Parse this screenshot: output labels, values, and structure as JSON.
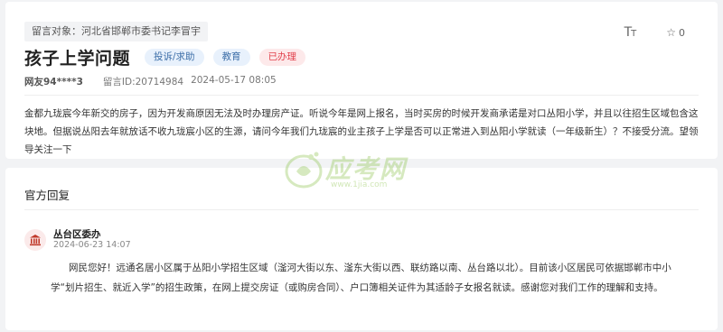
{
  "message": {
    "target": "留言对象：河北省邯郸市委书记李冒宇",
    "title": "孩子上学问题",
    "tags": {
      "type": "投诉/求助",
      "category": "教育",
      "status": "已办理"
    },
    "user": "网友94****3",
    "message_id": "留言ID:20714984",
    "date": "2024-05-17 08:05",
    "content": "金都九珑宸今年新交的房子，因为开发商原因无法及时办理房产证。听说今年是网上报名，当时买房的时候开发商承诺是对口丛阳小学，并且以往招生区域包含这块地。但据说丛阳去年就放话不收九珑宸小区的生源，请问今年我们九珑宸的业主孩子上学是否可以正常进入到丛阳小学就读（一年级新生）？不接受分流。望领导关注一下",
    "tools": {
      "font_icon": "font-size-icon",
      "font_label": "TT",
      "star_icon": "star-icon",
      "star_count": "0"
    }
  },
  "reply": {
    "heading": "官方回复",
    "org_name": "丛台区委办",
    "org_icon": "government-building-icon",
    "date": "2024-06-23 14:07",
    "content": "网民您好！远通名居小区属于丛阳小学招生区域（滏河大街以东、滏东大街以西、联纺路以南、丛台路以北）。目前该小区居民可依据邯郸市中小学“划片招生、就近入学”的招生政策，在网上提交房证（或购房合同）、户口簿相关证件为其适龄子女报名就读。感谢您对我们工作的理解和支持。"
  },
  "watermark": {
    "brand": "应考网",
    "url": "www.1jia.com"
  },
  "colors": {
    "page_bg": "#f2f3f5",
    "badge_blue_bg": "#e8f1fc",
    "badge_blue_text": "#3c6ea8",
    "badge_red_bg": "#fde9ea",
    "badge_red_text": "#e2434e",
    "org_icon": "#c0392b",
    "watermark": "#8bc34a"
  }
}
